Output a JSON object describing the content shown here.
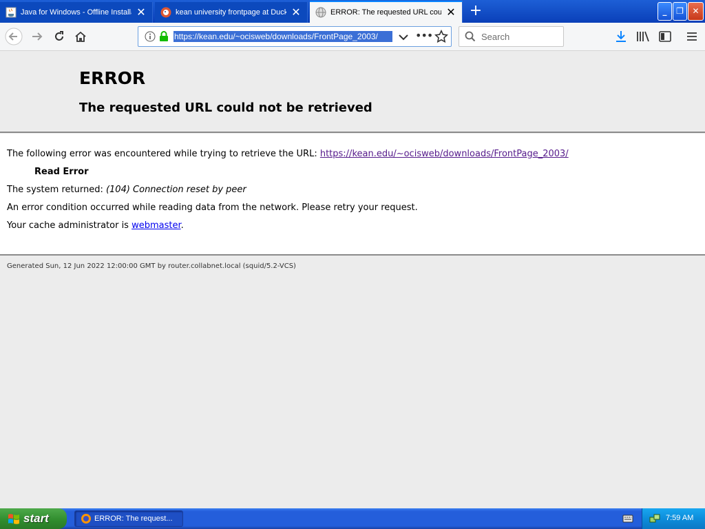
{
  "browser": {
    "tabs": [
      {
        "title": "Java for Windows - Offline Installation",
        "favicon": "java-icon",
        "active": false
      },
      {
        "title": "kean university frontpage at DuckDuckGo",
        "favicon": "duckduckgo-icon",
        "active": false
      },
      {
        "title": "ERROR: The requested URL could not be retrieved",
        "favicon": "globe-icon",
        "active": true
      }
    ],
    "new_tab_glyph": "+",
    "url": "https://kean.edu/~ocisweb/downloads/FrontPage_2003/",
    "search_placeholder": "Search",
    "more_glyph": "•••"
  },
  "page": {
    "title": "ERROR",
    "subtitle": "The requested URL could not be retrieved",
    "intro_text": "The following error was encountered while trying to retrieve the URL: ",
    "intro_link": "https://kean.edu/~ocisweb/downloads/FrontPage_2003/",
    "error_name": "Read Error",
    "system_returned_label": "The system returned: ",
    "system_returned_value": "(104) Connection reset by peer",
    "description": "An error condition occurred while reading data from the network. Please retry your request.",
    "admin_prefix": "Your cache administrator is ",
    "admin_link": "webmaster",
    "admin_suffix": ".",
    "footer": "Generated Sun, 12 Jun 2022 12:00:00 GMT by router.collabnet.local (squid/5.2-VCS)"
  },
  "taskbar": {
    "start_label": "start",
    "task_label": "ERROR: The request...",
    "clock": "7:59 AM"
  },
  "colors": {
    "tab_accent": "#0a84ff",
    "visited_link": "#551a8b",
    "unvisited_link": "#0000ee",
    "url_selection": "#3b6fd6",
    "start_green": "#2f8b2c",
    "taskbar_blue": "#245edb"
  }
}
